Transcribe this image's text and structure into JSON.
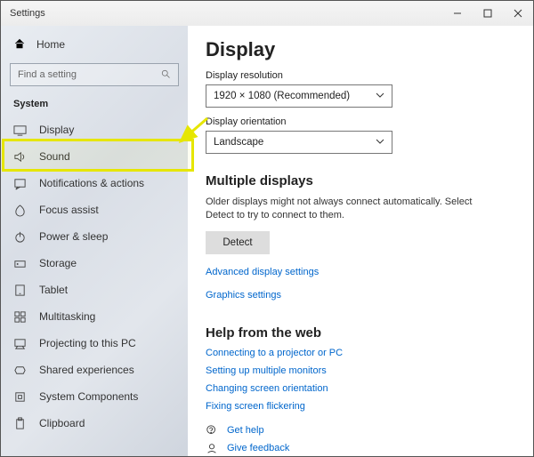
{
  "window": {
    "title": "Settings"
  },
  "sidebar": {
    "home": "Home",
    "search_placeholder": "Find a setting",
    "group": "System",
    "items": [
      {
        "label": "Display"
      },
      {
        "label": "Sound"
      },
      {
        "label": "Notifications & actions"
      },
      {
        "label": "Focus assist"
      },
      {
        "label": "Power & sleep"
      },
      {
        "label": "Storage"
      },
      {
        "label": "Tablet"
      },
      {
        "label": "Multitasking"
      },
      {
        "label": "Projecting to this PC"
      },
      {
        "label": "Shared experiences"
      },
      {
        "label": "System Components"
      },
      {
        "label": "Clipboard"
      }
    ]
  },
  "main": {
    "title": "Display",
    "resolution_label": "Display resolution",
    "resolution_value": "1920 × 1080 (Recommended)",
    "orientation_label": "Display orientation",
    "orientation_value": "Landscape",
    "multiple_heading": "Multiple displays",
    "multiple_desc": "Older displays might not always connect automatically. Select Detect to try to connect to them.",
    "detect_label": "Detect",
    "link_adv": "Advanced display settings",
    "link_gfx": "Graphics settings",
    "help_heading": "Help from the web",
    "help_links": [
      "Connecting to a projector or PC",
      "Setting up multiple monitors",
      "Changing screen orientation",
      "Fixing screen flickering"
    ],
    "get_help": "Get help",
    "feedback": "Give feedback"
  }
}
